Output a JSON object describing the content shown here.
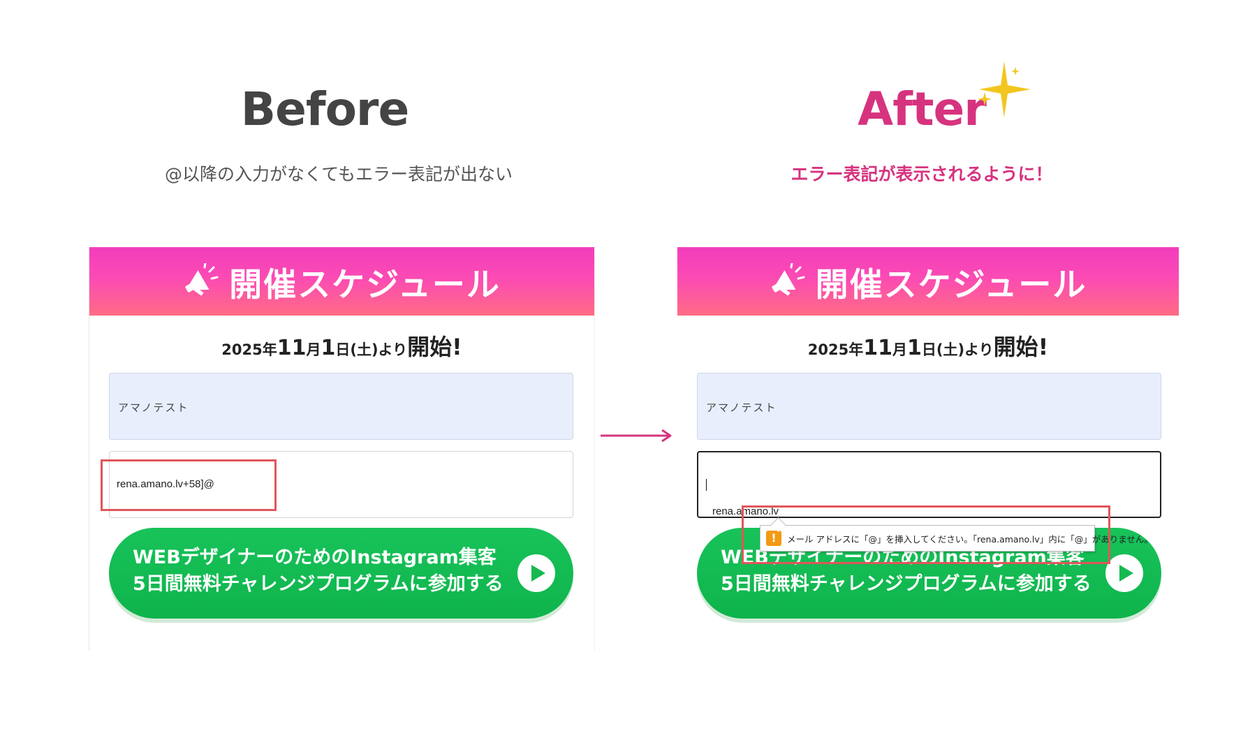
{
  "comparison": {
    "before": {
      "title": "Before",
      "caption": "@以降の入力がなくてもエラー表記が出ない"
    },
    "after": {
      "title": "After",
      "caption": "エラー表記が表示されるように！"
    }
  },
  "form": {
    "banner_title": "開催スケジュール",
    "date": {
      "year": "2025年",
      "month": "11",
      "month_unit": "月",
      "day": "1",
      "day_suffix": "日(土)より",
      "start": "開始!"
    },
    "name_value": "アマノテスト",
    "cta_line1": "WEBデザイナーのためのInstagram集客",
    "cta_line2": "5日間無料チャレンジプログラムに参加する"
  },
  "before_form": {
    "email_value": "rena.amano.lv+58]@"
  },
  "after_form": {
    "email_value": "rena.amano.lv",
    "validation_message": "メール アドレスに「@」を挿入してください。「rena.amano.lv」内に「@」がありません。"
  },
  "icons": {
    "banner": "megaphone-icon",
    "cta": "play-icon",
    "validation": "warning-icon",
    "decoration": "sparkle-icon",
    "transition": "arrow-right-icon"
  },
  "colors": {
    "accent": "#d6337f",
    "banner_gradient_top": "#f23dbd",
    "banner_gradient_bottom": "#ff6b84",
    "cta_green": "#14bd53",
    "highlight_red": "#e0565b",
    "sparkle_yellow": "#f2c61f"
  }
}
